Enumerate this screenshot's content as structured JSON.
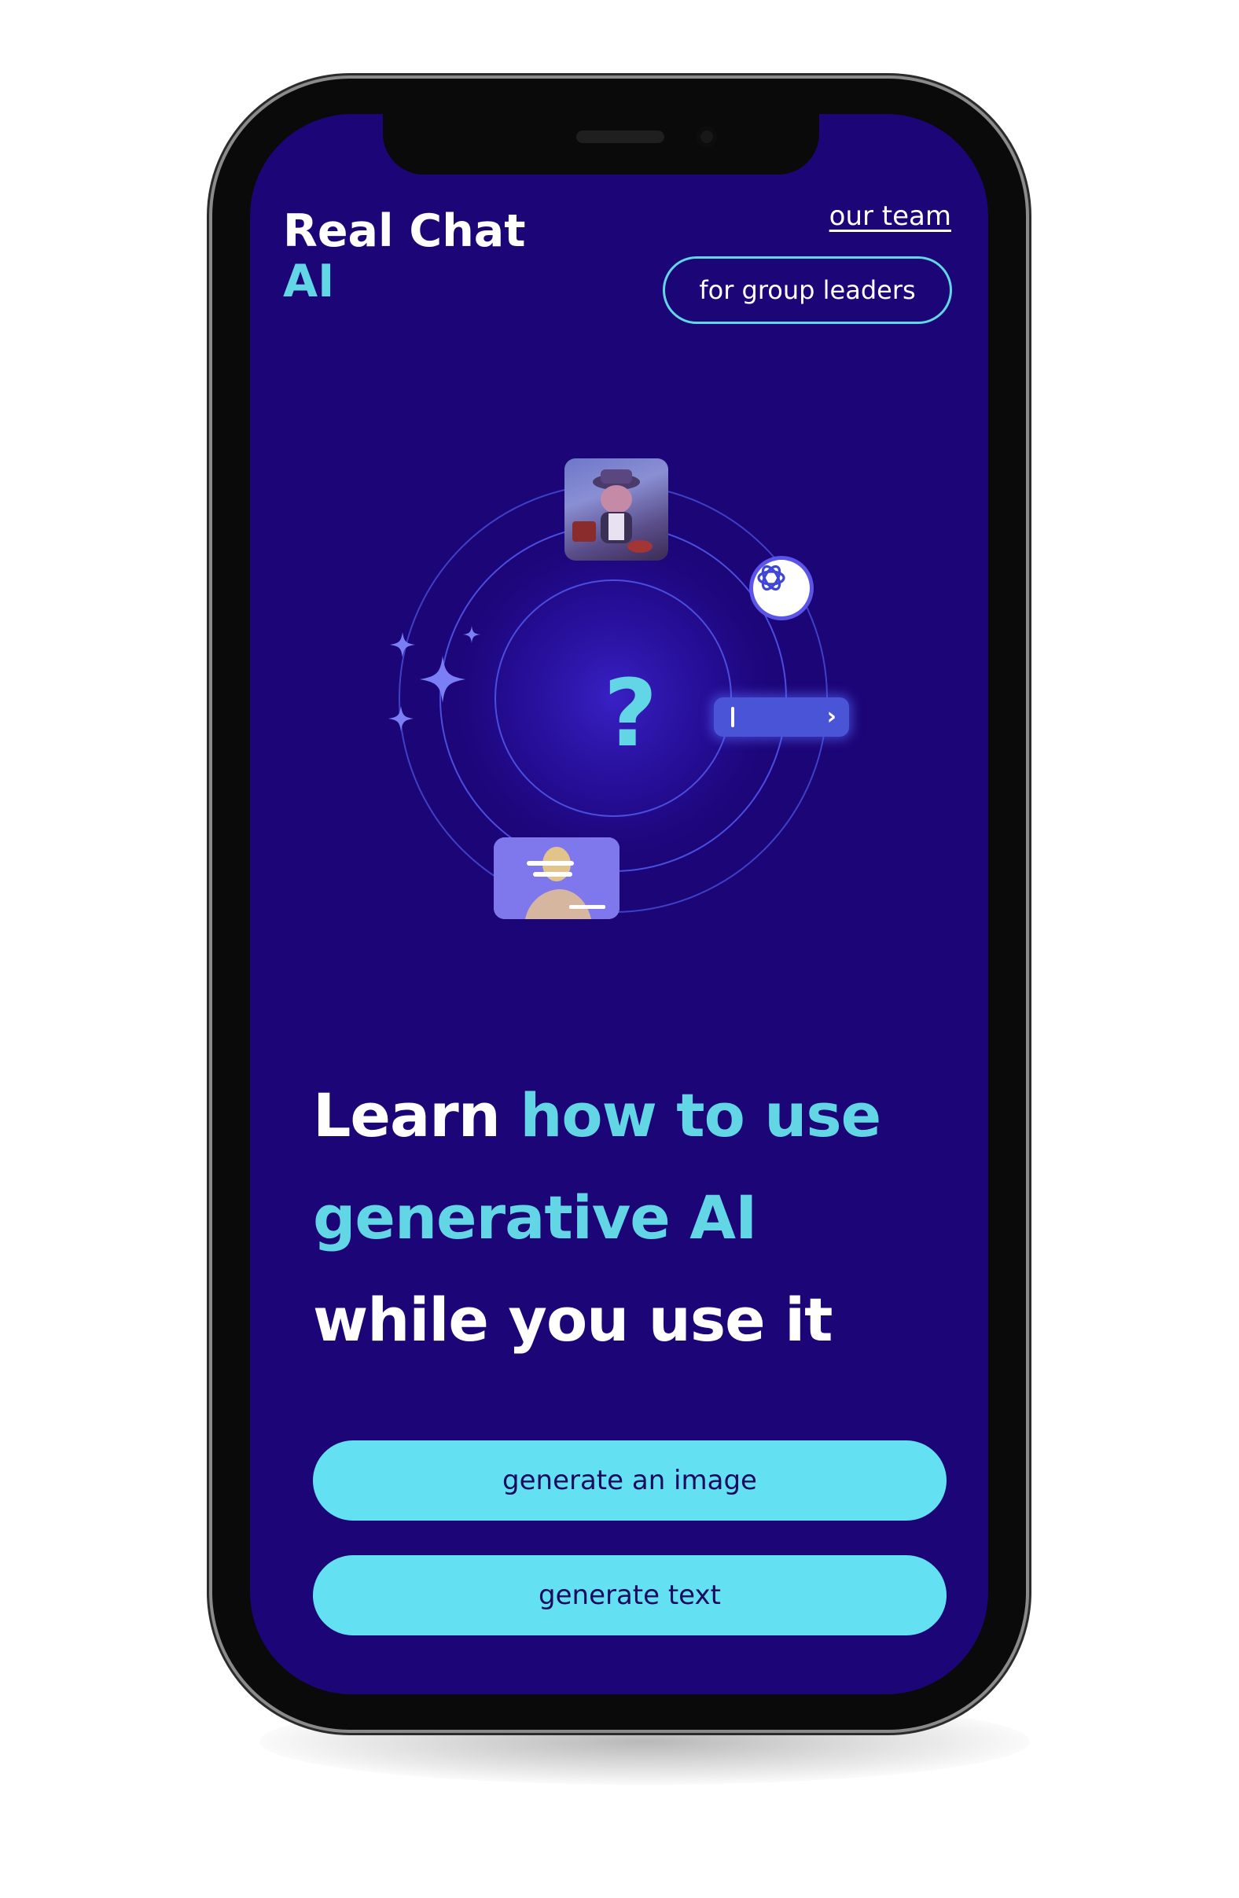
{
  "header": {
    "brand_line1": "Real Chat",
    "brand_line2": "AI",
    "nav_link": "our team",
    "group_leaders_button": "for group leaders"
  },
  "hero": {
    "question_mark": "?",
    "icons": [
      "sparkle-icon",
      "openai-icon",
      "chevron-right-icon",
      "text-cursor-icon"
    ]
  },
  "headline": {
    "part1": "Learn ",
    "part2": "how to use",
    "part3": "generative AI",
    "part4": "while you use it"
  },
  "actions": {
    "generate_image": "generate an image",
    "generate_text": "generate text"
  },
  "colors": {
    "background": "#1c0577",
    "accent": "#63d6e6",
    "button": "#63e1f2",
    "button_text": "#1a0b5e"
  }
}
